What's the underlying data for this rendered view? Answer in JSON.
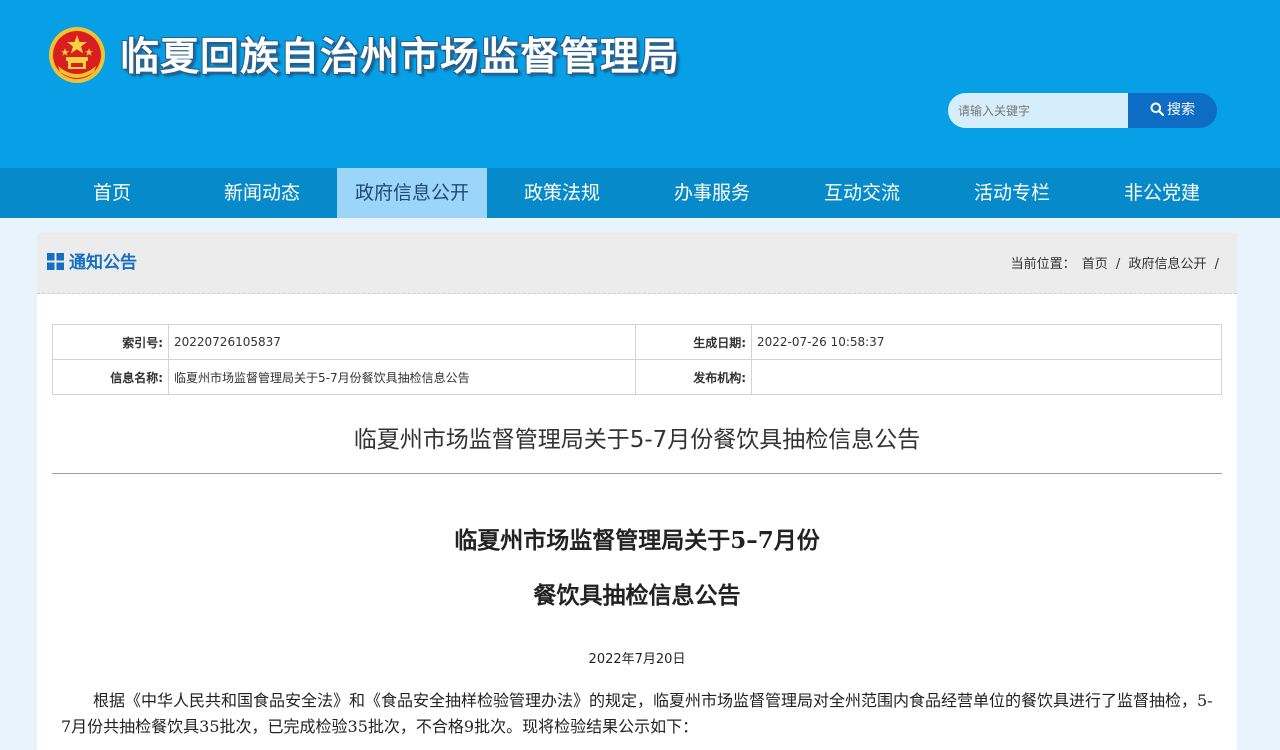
{
  "header": {
    "site_title": "临夏回族自治州市场监督管理局",
    "search_placeholder": "请输入关键字",
    "search_button": "搜索"
  },
  "nav": {
    "items": [
      "首页",
      "新闻动态",
      "政府信息公开",
      "政策法规",
      "办事服务",
      "互动交流",
      "活动专栏",
      "非公党建"
    ],
    "active_index": 2
  },
  "section": {
    "title": "通知公告",
    "breadcrumb_prefix": "当前位置：",
    "breadcrumb": [
      "首页",
      "政府信息公开"
    ],
    "separator": "/"
  },
  "info": {
    "index_label": "索引号:",
    "index_value": "20220726105837",
    "date_label": "生成日期:",
    "date_value": "2022-07-26 10:58:37",
    "name_label": "信息名称:",
    "name_value": "临夏州市场监督管理局关于5-7月份餐饮具抽检信息公告",
    "publisher_label": "发布机构:",
    "publisher_value": ""
  },
  "article": {
    "title": "临夏州市场监督管理局关于5-7月份餐饮具抽检信息公告",
    "heading_line1": "临夏州市场监督管理局关于5–7月份",
    "heading_line2": "餐饮具抽检信息公告",
    "date": "2022年7月20日",
    "paragraph": "根据《中华人民共和国食品安全法》和《食品安全抽样检验管理办法》的规定，临夏州市场监督管理局对全州范围内食品经营单位的餐饮具进行了监督抽检，5-7月份共抽检餐饮具35批次，已完成检验35批次，不合格9批次。现将检验结果公示如下："
  },
  "colors": {
    "header_bg": "#079fe6",
    "nav_bg": "#068ac9",
    "nav_active": "#9bd5f8",
    "search_button": "#0d6cc3",
    "section_title": "#1570c2"
  }
}
